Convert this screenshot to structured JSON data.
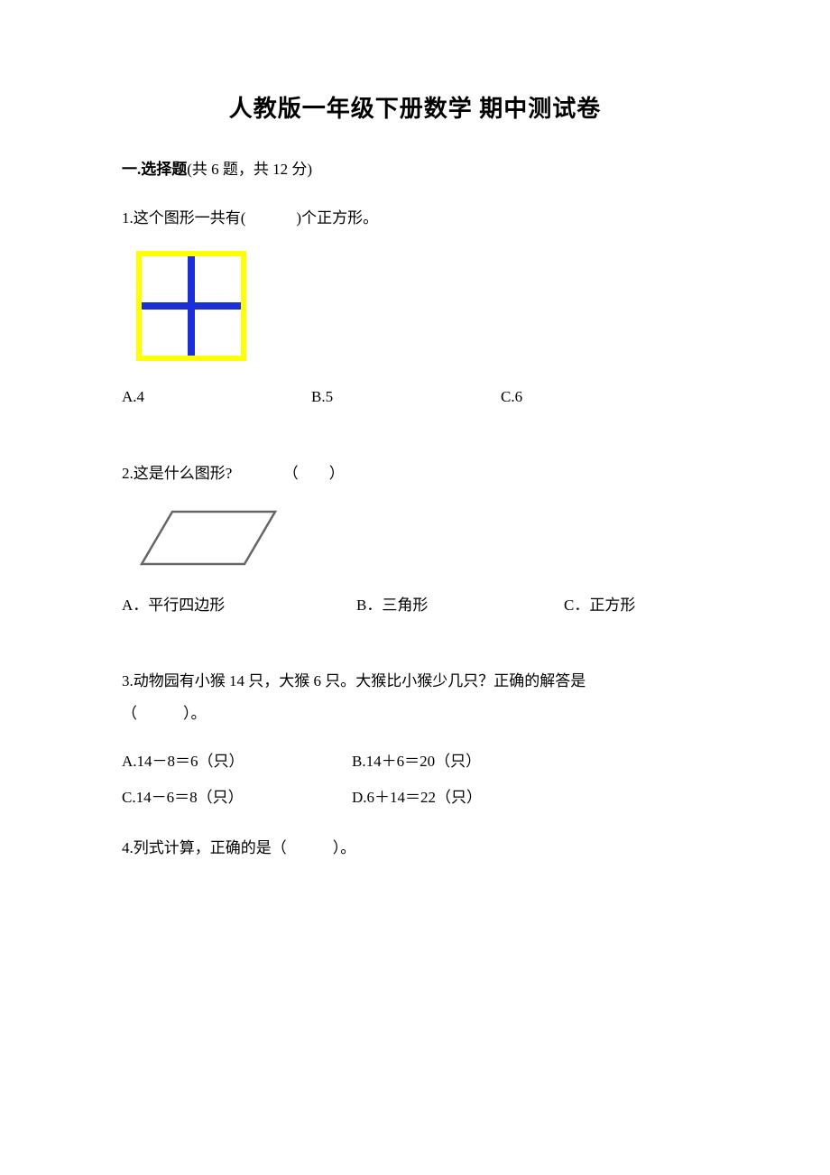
{
  "title": "人教版一年级下册数学 期中测试卷",
  "section1": {
    "label_prefix": "一.选择题",
    "label_detail": "(共 6 题，共 12 分)"
  },
  "q1": {
    "text_prefix": "1.这个图形一共有(",
    "text_suffix": ")个正方形。",
    "optA": "A.4",
    "optB": "B.5",
    "optC": "C.6"
  },
  "q2": {
    "text_prefix": "2.这是什么图形?",
    "paren": "（　　）",
    "optA": "A．平行四边形",
    "optB": "B．三角形",
    "optC": "C．正方形"
  },
  "q3": {
    "line1": "3.动物园有小猴 14 只，大猴 6 只。大猴比小猴少几只？正确的解答是",
    "line2": "（　　　）。",
    "optA": "A.14－8＝6（只）",
    "optB": "B.14＋6＝20（只）",
    "optC": "C.14－6＝8（只）",
    "optD": "D.6＋14＝22（只）"
  },
  "q4": {
    "text": "4.列式计算，正确的是（　　　）。"
  }
}
